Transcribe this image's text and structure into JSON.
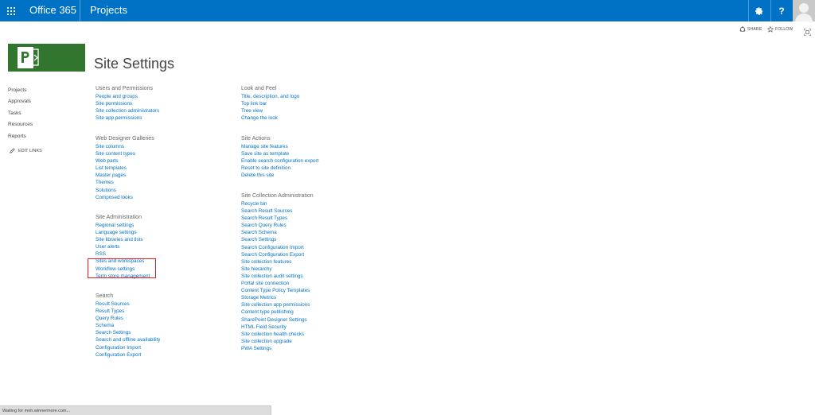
{
  "suitebar": {
    "brand": "Office 365",
    "app_title": "Projects",
    "help_glyph": "?"
  },
  "actions": {
    "share": "SHARE",
    "follow": "FOLLOW"
  },
  "page": {
    "title": "Site Settings"
  },
  "quicklaunch": {
    "items": [
      "Projects",
      "Approvals",
      "Tasks",
      "Resources",
      "Reports"
    ],
    "edit_links": "EDIT LINKS"
  },
  "columns": {
    "left": [
      {
        "title": "Users and Permissions",
        "links": [
          "People and groups",
          "Site permissions",
          "Site collection administrators",
          "Site app permissions"
        ]
      },
      {
        "title": "Web Designer Galleries",
        "links": [
          "Site columns",
          "Site content types",
          "Web parts",
          "List templates",
          "Master pages",
          "Themes",
          "Solutions",
          "Composed looks"
        ]
      },
      {
        "title": "Site Administration",
        "links": [
          "Regional settings",
          "Language settings",
          "Site libraries and lists",
          "User alerts",
          "RSS",
          "Sites and workspaces",
          "Workflow settings",
          "Term store management"
        ]
      },
      {
        "title": "Search",
        "links": [
          "Result Sources",
          "Result Types",
          "Query Rules",
          "Schema",
          "Search Settings",
          "Search and offline availability",
          "Configuration Import",
          "Configuration Export"
        ]
      }
    ],
    "right": [
      {
        "title": "Look and Feel",
        "links": [
          "Title, description, and logo",
          "Top link bar",
          "Tree view",
          "Change the look"
        ]
      },
      {
        "title": "Site Actions",
        "links": [
          "Manage site features",
          "Save site as template",
          "Enable search configuration export",
          "Reset to site definition",
          "Delete this site"
        ]
      },
      {
        "title": "Site Collection Administration",
        "links": [
          "Recycle bin",
          "Search Result Sources",
          "Search Result Types",
          "Search Query Rules",
          "Search Schema",
          "Search Settings",
          "Search Configuration Import",
          "Search Configuration Export",
          "Site collection features",
          "Site hierarchy",
          "Site collection audit settings",
          "Portal site connection",
          "Content Type Policy Templates",
          "Storage Metrics",
          "Site collection app permissions",
          "Content type publishing",
          "SharePoint Designer Settings",
          "HTML Field Security",
          "Site collection health checks",
          "Site collection upgrade",
          "PWA Settings"
        ]
      }
    ]
  },
  "status": {
    "text": "Waiting for mnh.winnermore.com..."
  },
  "colors": {
    "suitebar": "#0072c6",
    "link": "#0072c6",
    "logo": "#31752f",
    "highlight": "#e51c23"
  },
  "icons": {
    "waffle": "app-launcher-icon",
    "gear": "gear-icon",
    "help": "help-icon",
    "share": "share-icon",
    "follow": "star-icon",
    "focus": "focus-mode-icon",
    "edit": "pencil-icon"
  }
}
